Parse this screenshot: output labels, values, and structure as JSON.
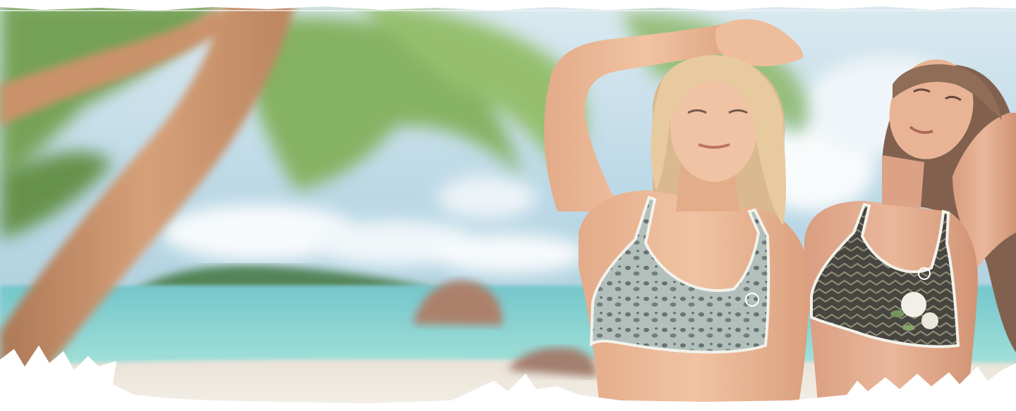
{
  "hero": {
    "description_colors": {
      "sky_top": "#bcd9ea",
      "sky_bottom": "#9cc4d8",
      "sea": "#6ccfd0",
      "sand": "#efe6da",
      "palm_trunk": "#c98e63",
      "palm_leaves": "#7fae5a",
      "skin": "#e8b28e",
      "hair_blonde": "#e7c79a",
      "hair_brown": "#7a5843",
      "torn_edge": "#ffffff"
    },
    "icons": [
      "torn-paper-edge",
      "palm-tree",
      "island",
      "rock"
    ]
  }
}
